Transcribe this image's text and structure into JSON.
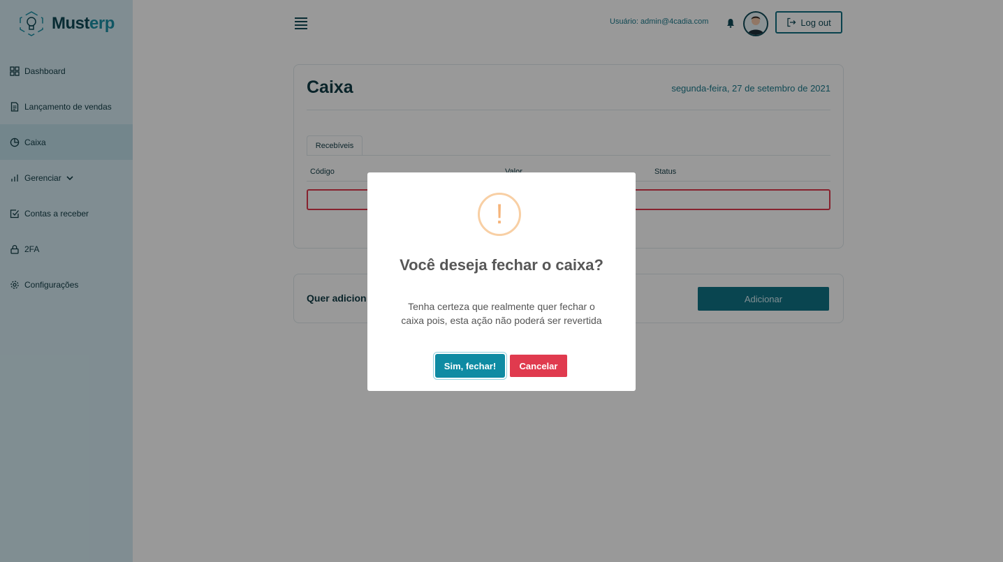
{
  "brand": {
    "name_part1": "Must",
    "name_part2": "erp"
  },
  "sidebar": {
    "items": [
      {
        "label": "Dashboard",
        "icon": "grid-icon"
      },
      {
        "label": "Lançamento de vendas",
        "icon": "document-icon"
      },
      {
        "label": "Caixa",
        "icon": "pie-chart-icon",
        "active": true
      },
      {
        "label": "Gerenciar",
        "icon": "bar-chart-icon",
        "has_submenu": true
      },
      {
        "label": "Contas a receber",
        "icon": "check-square-icon"
      },
      {
        "label": "2FA",
        "icon": "lock-icon"
      },
      {
        "label": "Configurações",
        "icon": "gear-icon"
      }
    ]
  },
  "header": {
    "user_label": "Usuário: admin@4cadia.com",
    "logout_label": "Log out"
  },
  "page": {
    "title": "Caixa",
    "date": "segunda-feira, 27 de setembro de 2021",
    "tabs": [
      "Recebíveis"
    ],
    "table": {
      "columns": [
        "Código",
        "Valor",
        "Status"
      ]
    },
    "add_prompt": "Quer adicion",
    "add_button": "Adicionar"
  },
  "modal": {
    "icon": "warning-icon",
    "icon_glyph": "!",
    "title": "Você deseja fechar o caixa?",
    "text": "Tenha certeza que realmente quer fechar o caixa pois, esta ação não poderá ser revertida",
    "confirm_label": "Sim, fechar!",
    "cancel_label": "Cancelar"
  },
  "colors": {
    "sidebar_bg": "#d6ecf3",
    "accent": "#0f7486",
    "danger": "#e03a4e",
    "warning": "#f5b47a"
  }
}
